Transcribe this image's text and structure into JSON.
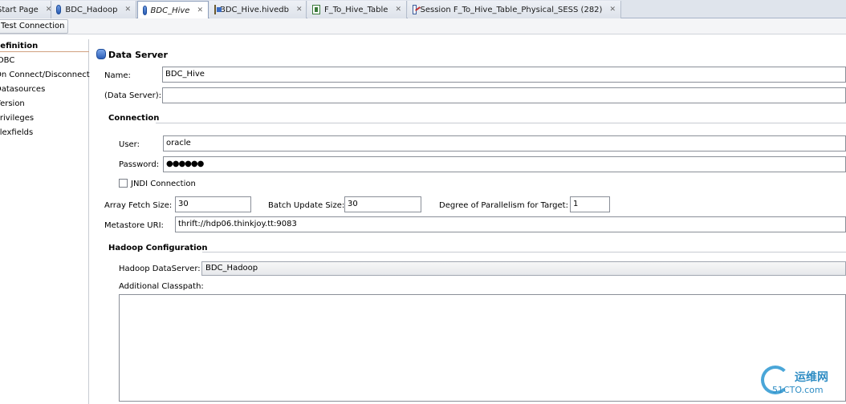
{
  "tabs": [
    {
      "label": "Start Page",
      "icon": "none",
      "active": false
    },
    {
      "label": "BDC_Hadoop",
      "icon": "database-icon",
      "active": false
    },
    {
      "label": "BDC_Hive",
      "icon": "database-icon",
      "active": true
    },
    {
      "label": "BDC_Hive.hivedb",
      "icon": "model-icon",
      "active": false
    },
    {
      "label": "F_To_Hive_Table",
      "icon": "mapping-icon",
      "active": false
    },
    {
      "label": "Session F_To_Hive_Table_Physical_SESS (282)",
      "icon": "session-icon",
      "active": false
    }
  ],
  "toolbar": {
    "test_connection": "Test Connection"
  },
  "nav": [
    {
      "label": "Definition",
      "selected": true
    },
    {
      "label": "JDBC"
    },
    {
      "label": "On Connect/Disconnect"
    },
    {
      "label": "Datasources"
    },
    {
      "label": "Version"
    },
    {
      "label": "Privileges"
    },
    {
      "label": "Flexfields"
    }
  ],
  "form": {
    "header": "Data Server",
    "name_label": "Name:",
    "name_value": "BDC_Hive",
    "dataserver_label": "(Data Server):",
    "dataserver_value": "",
    "connection_section": "Connection",
    "user_label": "User:",
    "user_value": "oracle",
    "password_label": "Password:",
    "password_value": "●●●●●●",
    "jndi_label": "JNDI Connection",
    "jndi_checked": false,
    "array_fetch_label": "Array Fetch Size:",
    "array_fetch_value": "30",
    "batch_update_label": "Batch Update Size:",
    "batch_update_value": "30",
    "parallelism_label": "Degree of Parallelism for Target:",
    "parallelism_value": "1",
    "metastore_label": "Metastore URI:",
    "metastore_value": "thrift://hdp06.thinkjoy.tt:9083",
    "hadoop_section": "Hadoop Configuration",
    "hadoop_ds_label": "Hadoop DataServer:",
    "hadoop_ds_value": "BDC_Hadoop",
    "classpath_label": "Additional Classpath:",
    "classpath_value": ""
  },
  "watermark": {
    "cn": "运维网",
    "en": "51CTO.com"
  },
  "colors": {
    "tabbar": "#dfe4ec",
    "accent_blue": "#2d5fb8",
    "watermark": "#2f8dc4"
  }
}
